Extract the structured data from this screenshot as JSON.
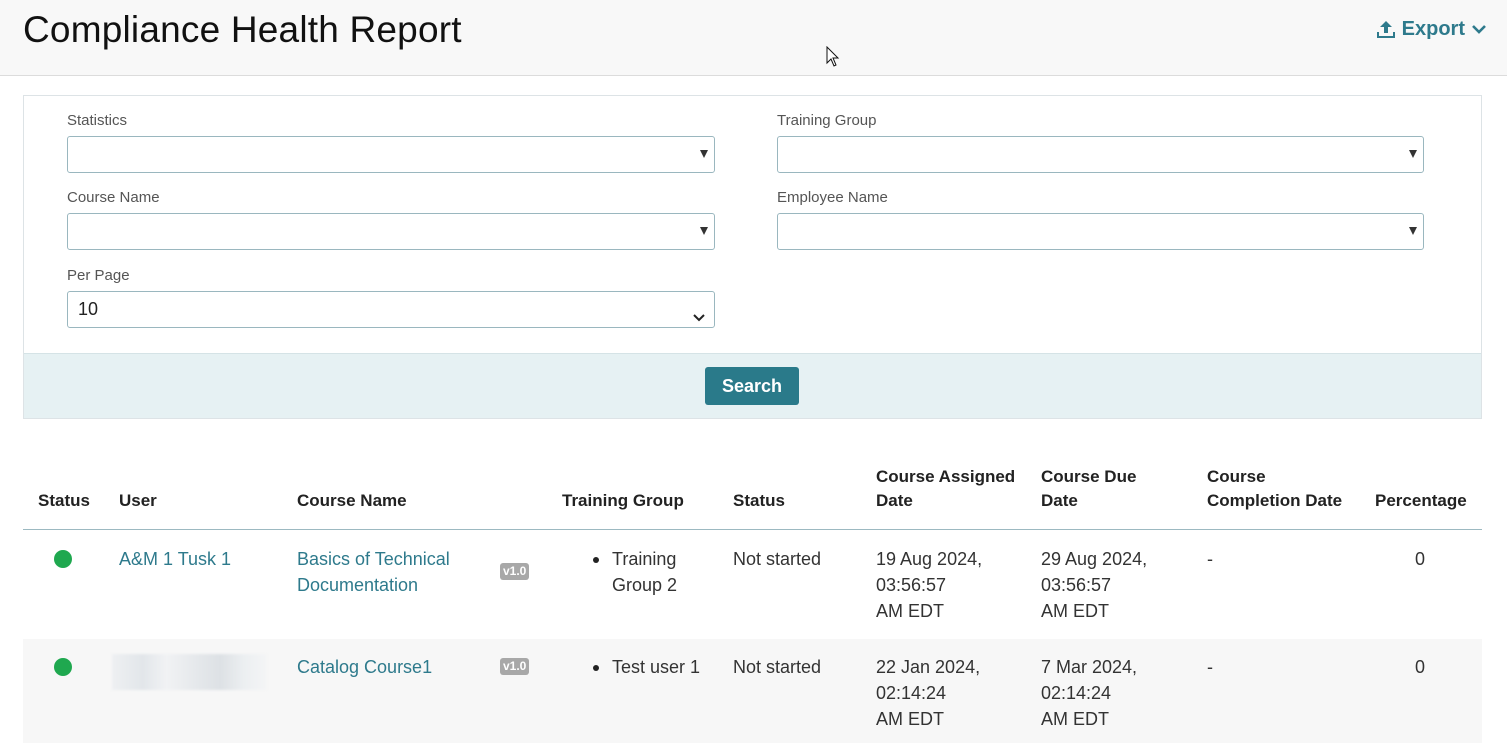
{
  "header": {
    "title": "Compliance Health Report",
    "export_label": "Export",
    "export_icon": "upload-icon",
    "export_caret_icon": "chevron-down-icon"
  },
  "filters": {
    "statistics_label": "Statistics",
    "statistics_value": "",
    "training_group_label": "Training Group",
    "training_group_value": "",
    "course_name_label": "Course Name",
    "course_name_value": "",
    "employee_name_label": "Employee Name",
    "employee_name_value": "",
    "per_page_label": "Per Page",
    "per_page_value": "10",
    "search_label": "Search"
  },
  "table": {
    "headers": {
      "status_indicator": "Status",
      "user": "User",
      "course_name": "Course Name",
      "training_group": "Training Group",
      "status": "Status",
      "assigned_line1": "Course Assigned",
      "assigned_line2": "Date",
      "due_line1": "Course Due",
      "due_line2": "Date",
      "completion_line1": "Course",
      "completion_line2": "Completion Date",
      "percentage": "Percentage"
    },
    "rows": [
      {
        "indicator_color": "#1fa84f",
        "user": "A&M 1 Tusk 1",
        "course_line1": "Basics of Technical",
        "course_line2": "Documentation",
        "version": "v1.0",
        "group_line1": "Training",
        "group_line2": "Group 2",
        "status": "Not started",
        "assigned_line1": "19 Aug 2024,",
        "assigned_line2": "03:56:57",
        "assigned_line3": "AM EDT",
        "due_line1": "29 Aug 2024,",
        "due_line2": "03:56:57",
        "due_line3": "AM EDT",
        "completion": "-",
        "percentage": "0"
      },
      {
        "indicator_color": "#1fa84f",
        "user": "",
        "course_line1": "Catalog Course1",
        "course_line2": "",
        "version": "v1.0",
        "group_line1": "Test user 1",
        "group_line2": "",
        "status": "Not started",
        "assigned_line1": "22 Jan 2024,",
        "assigned_line2": "02:14:24",
        "assigned_line3": "AM EDT",
        "due_line1": "7 Mar 2024,",
        "due_line2": "02:14:24",
        "due_line3": "AM EDT",
        "completion": "-",
        "percentage": "0"
      }
    ]
  },
  "colors": {
    "accent": "#2a7a8a",
    "link": "#2e7a8c",
    "status_green": "#1fa84f"
  }
}
